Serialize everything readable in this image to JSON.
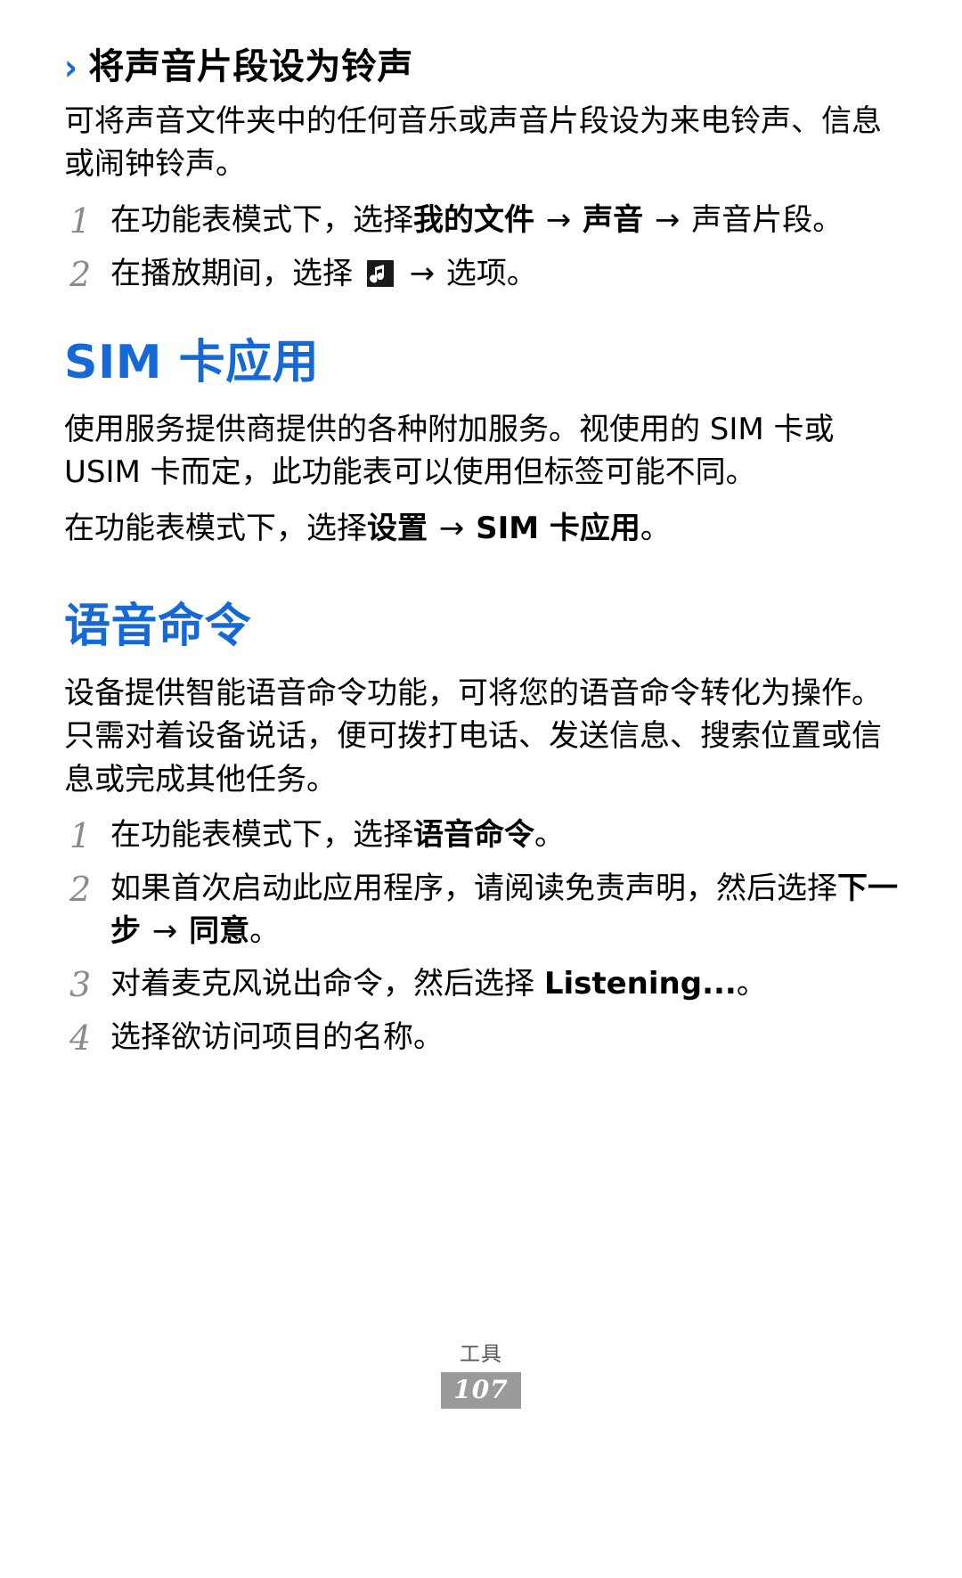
{
  "page": {
    "number": "107",
    "footer_label": "工具",
    "accent_color": "#1569d6",
    "badge_color": "#9a9a9a"
  },
  "subsection": {
    "chevron": "›",
    "title": "将声音片段设为铃声",
    "intro": "可将声音文件夹中的任何音乐或声音片段设为来电铃声、信息或闹钟铃声。",
    "steps": [
      {
        "num": "1",
        "parts": [
          {
            "text": "在功能表模式下，选择",
            "bold": false
          },
          {
            "text": "我的文件",
            "bold": true
          },
          {
            "text": " → ",
            "bold": false,
            "arrow": true
          },
          {
            "text": "声音",
            "bold": true
          },
          {
            "text": " → ",
            "bold": false,
            "arrow": true
          },
          {
            "text": "声音片段。",
            "bold": false
          }
        ]
      },
      {
        "num": "2",
        "parts": [
          {
            "text": "在播放期间，选择 ",
            "bold": false
          },
          {
            "icon": "music-note-icon"
          },
          {
            "text": " → ",
            "bold": false,
            "arrow": true
          },
          {
            "text": "选项。",
            "bold": false
          }
        ]
      }
    ]
  },
  "sim_section": {
    "title": "SIM 卡应用",
    "intro": "使用服务提供商提供的各种附加服务。视使用的 SIM 卡或 USIM 卡而定，此功能表可以使用但标签可能不同。",
    "instruction_parts": [
      {
        "text": "在功能表模式下，选择",
        "bold": false
      },
      {
        "text": "设置",
        "bold": true
      },
      {
        "text": " → ",
        "bold": false,
        "arrow": true
      },
      {
        "text": "SIM 卡应用",
        "bold": true
      },
      {
        "text": "。",
        "bold": false
      }
    ]
  },
  "voice_section": {
    "title": "语音命令",
    "intro": "设备提供智能语音命令功能，可将您的语音命令转化为操作。只需对着设备说话，便可拨打电话、发送信息、搜索位置或信息或完成其他任务。",
    "steps": [
      {
        "num": "1",
        "parts": [
          {
            "text": "在功能表模式下，选择",
            "bold": false
          },
          {
            "text": "语音命令",
            "bold": true
          },
          {
            "text": "。",
            "bold": false
          }
        ]
      },
      {
        "num": "2",
        "parts": [
          {
            "text": "如果首次启动此应用程序，请阅读免责声明，然后选择",
            "bold": false
          },
          {
            "text": "下一步",
            "bold": true
          },
          {
            "text": " → ",
            "bold": false,
            "arrow": true
          },
          {
            "text": "同意",
            "bold": true
          },
          {
            "text": "。",
            "bold": false
          }
        ]
      },
      {
        "num": "3",
        "parts": [
          {
            "text": "对着麦克风说出命令，然后选择 ",
            "bold": false
          },
          {
            "text": "Listening...",
            "bold": true
          },
          {
            "text": "。",
            "bold": false
          }
        ]
      },
      {
        "num": "4",
        "parts": [
          {
            "text": "选择欲访问项目的名称。",
            "bold": false
          }
        ]
      }
    ]
  }
}
